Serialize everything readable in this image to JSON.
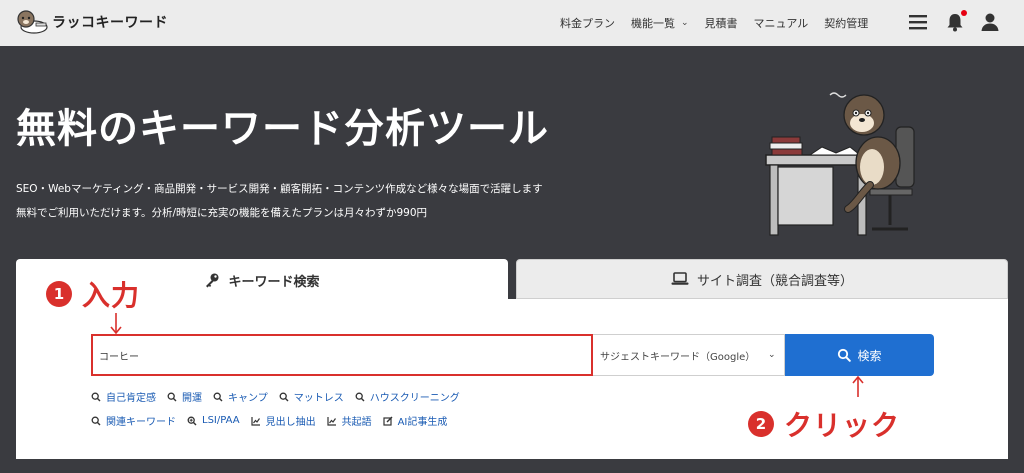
{
  "header": {
    "brand": "ラッコキーワード",
    "nav": [
      {
        "label": "料金プラン"
      },
      {
        "label": "機能一覧"
      },
      {
        "label": "見積書"
      },
      {
        "label": "マニュアル"
      },
      {
        "label": "契約管理"
      }
    ],
    "dropdown_chevron": "⌄"
  },
  "hero": {
    "title": "無料のキーワード分析ツール",
    "desc1": "SEO・Webマーケティング・商品開発・サービス開発・顧客開拓・コンテンツ作成など様々な場面で活躍します",
    "desc2": "無料でご利用いただけます。分析/時短に充実の機能を備えたプランは月々わずか990円"
  },
  "tabs": {
    "keyword": "キーワード検索",
    "site": "サイト調査（競合調査等）"
  },
  "search": {
    "value": "コーヒー",
    "select_value": "サジェストキーワード（Google）",
    "select_chevron": "⌄",
    "button_label": "検索"
  },
  "suggestions": [
    "自己肯定感",
    "開運",
    "キャンプ",
    "マットレス",
    "ハウスクリーニング"
  ],
  "tools": [
    {
      "label": "関連キーワード",
      "icon": "search-icon"
    },
    {
      "label": "LSI/PAA",
      "icon": "search-plus-icon"
    },
    {
      "label": "見出し抽出",
      "icon": "line-chart-icon"
    },
    {
      "label": "共起語",
      "icon": "line-chart-icon"
    },
    {
      "label": "AI記事生成",
      "icon": "edit-icon"
    }
  ],
  "annotations": {
    "step1_num": "1",
    "step1_text": "入力",
    "step2_num": "2",
    "step2_text": "クリック"
  },
  "colors": {
    "accent_blue": "#1f6fd1",
    "annotation_red": "#d9302c",
    "hero_bg": "#3a3b40",
    "link_blue": "#1a5bb3"
  }
}
